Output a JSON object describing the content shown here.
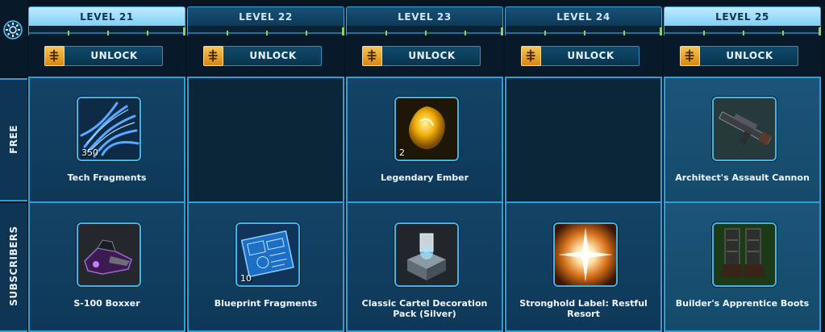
{
  "rail": {
    "free_label": "FREE",
    "subscribers_label": "SUBSCRIBERS",
    "settings_icon": "gear-icon"
  },
  "unlock_icon": "credit-stack-icon",
  "columns": [
    {
      "level": "LEVEL 21",
      "header_style": "light",
      "unlock_label": "UNLOCK",
      "free": {
        "name": "Tech Fragments",
        "quantity": "350",
        "icon": "tech-fragments-icon"
      },
      "subscriber": {
        "name": "S-100 Boxxer",
        "quantity": "",
        "icon": "speeder-icon"
      }
    },
    {
      "level": "LEVEL 22",
      "header_style": "dark",
      "unlock_label": "UNLOCK",
      "free": null,
      "subscriber": {
        "name": "Blueprint Fragments",
        "quantity": "10",
        "icon": "blueprint-fragments-icon"
      }
    },
    {
      "level": "LEVEL 23",
      "header_style": "dark",
      "unlock_label": "UNLOCK",
      "free": {
        "name": "Legendary Ember",
        "quantity": "2",
        "icon": "legendary-ember-icon"
      },
      "subscriber": {
        "name": "Classic Cartel Decoration Pack (Silver)",
        "quantity": "",
        "icon": "decoration-pack-icon"
      }
    },
    {
      "level": "LEVEL 24",
      "header_style": "dark",
      "unlock_label": "UNLOCK",
      "free": null,
      "subscriber": {
        "name": "Stronghold Label: Restful Resort",
        "quantity": "",
        "icon": "stronghold-label-icon"
      }
    },
    {
      "level": "LEVEL 25",
      "header_style": "light",
      "unlock_label": "UNLOCK",
      "free": {
        "name": "Architect's Assault Cannon",
        "quantity": "",
        "icon": "assault-cannon-icon"
      },
      "subscriber": {
        "name": "Builder's Apprentice Boots",
        "quantity": "",
        "icon": "boots-icon"
      }
    }
  ]
}
